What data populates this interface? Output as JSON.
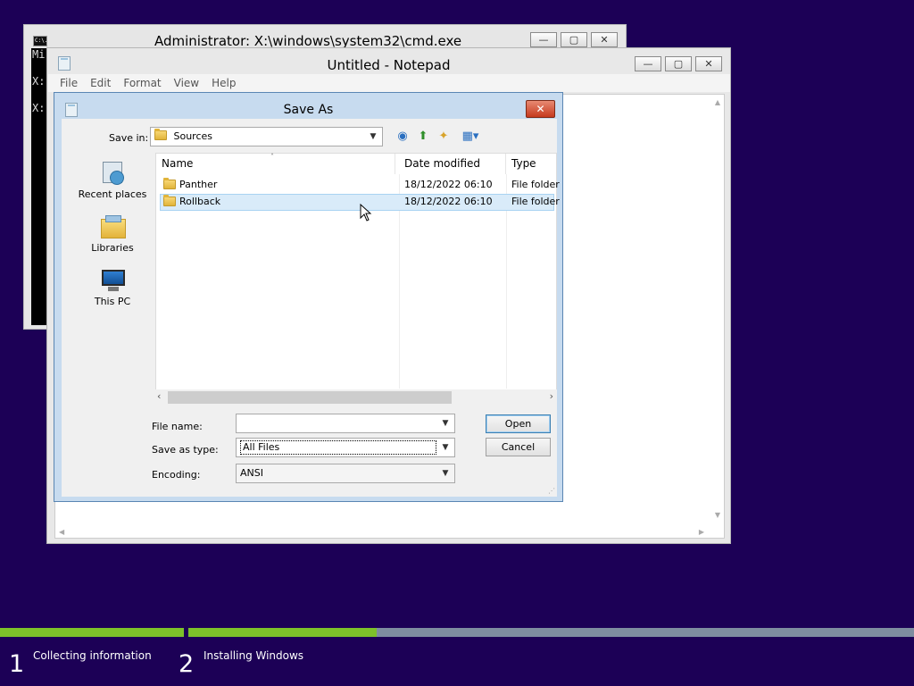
{
  "cmd": {
    "title": "Administrator: X:\\windows\\system32\\cmd.exe",
    "icon_text": "C:\\.",
    "lines": [
      "Mi",
      "",
      "X:",
      "",
      "X:"
    ]
  },
  "notepad": {
    "title": "Untitled - Notepad",
    "menu": [
      "File",
      "Edit",
      "Format",
      "View",
      "Help"
    ]
  },
  "dialog": {
    "title": "Save As",
    "close_glyph": "✕",
    "save_in_label": "Save in:",
    "save_in_value": "Sources",
    "places": [
      "Recent places",
      "Libraries",
      "This PC"
    ],
    "columns": [
      "Name",
      "Date modified",
      "Type"
    ],
    "rows": [
      {
        "name": "Panther",
        "date": "18/12/2022 06:10",
        "type": "File folder"
      },
      {
        "name": "Rollback",
        "date": "18/12/2022 06:10",
        "type": "File folder"
      }
    ],
    "file_name_label": "File name:",
    "file_name_value": "",
    "save_type_label": "Save as type:",
    "save_type_value": "All Files",
    "encoding_label": "Encoding:",
    "encoding_value": "ANSI",
    "open_label": "Open",
    "cancel_label": "Cancel"
  },
  "setup": {
    "steps": [
      {
        "num": "1",
        "label": "Collecting information",
        "progress": 1.0
      },
      {
        "num": "2",
        "label": "Installing Windows",
        "progress": 0.26
      }
    ]
  },
  "colors": {
    "background": "#1c0056",
    "progress_fill": "#7dc12a",
    "progress_track": "#7e8da0"
  }
}
